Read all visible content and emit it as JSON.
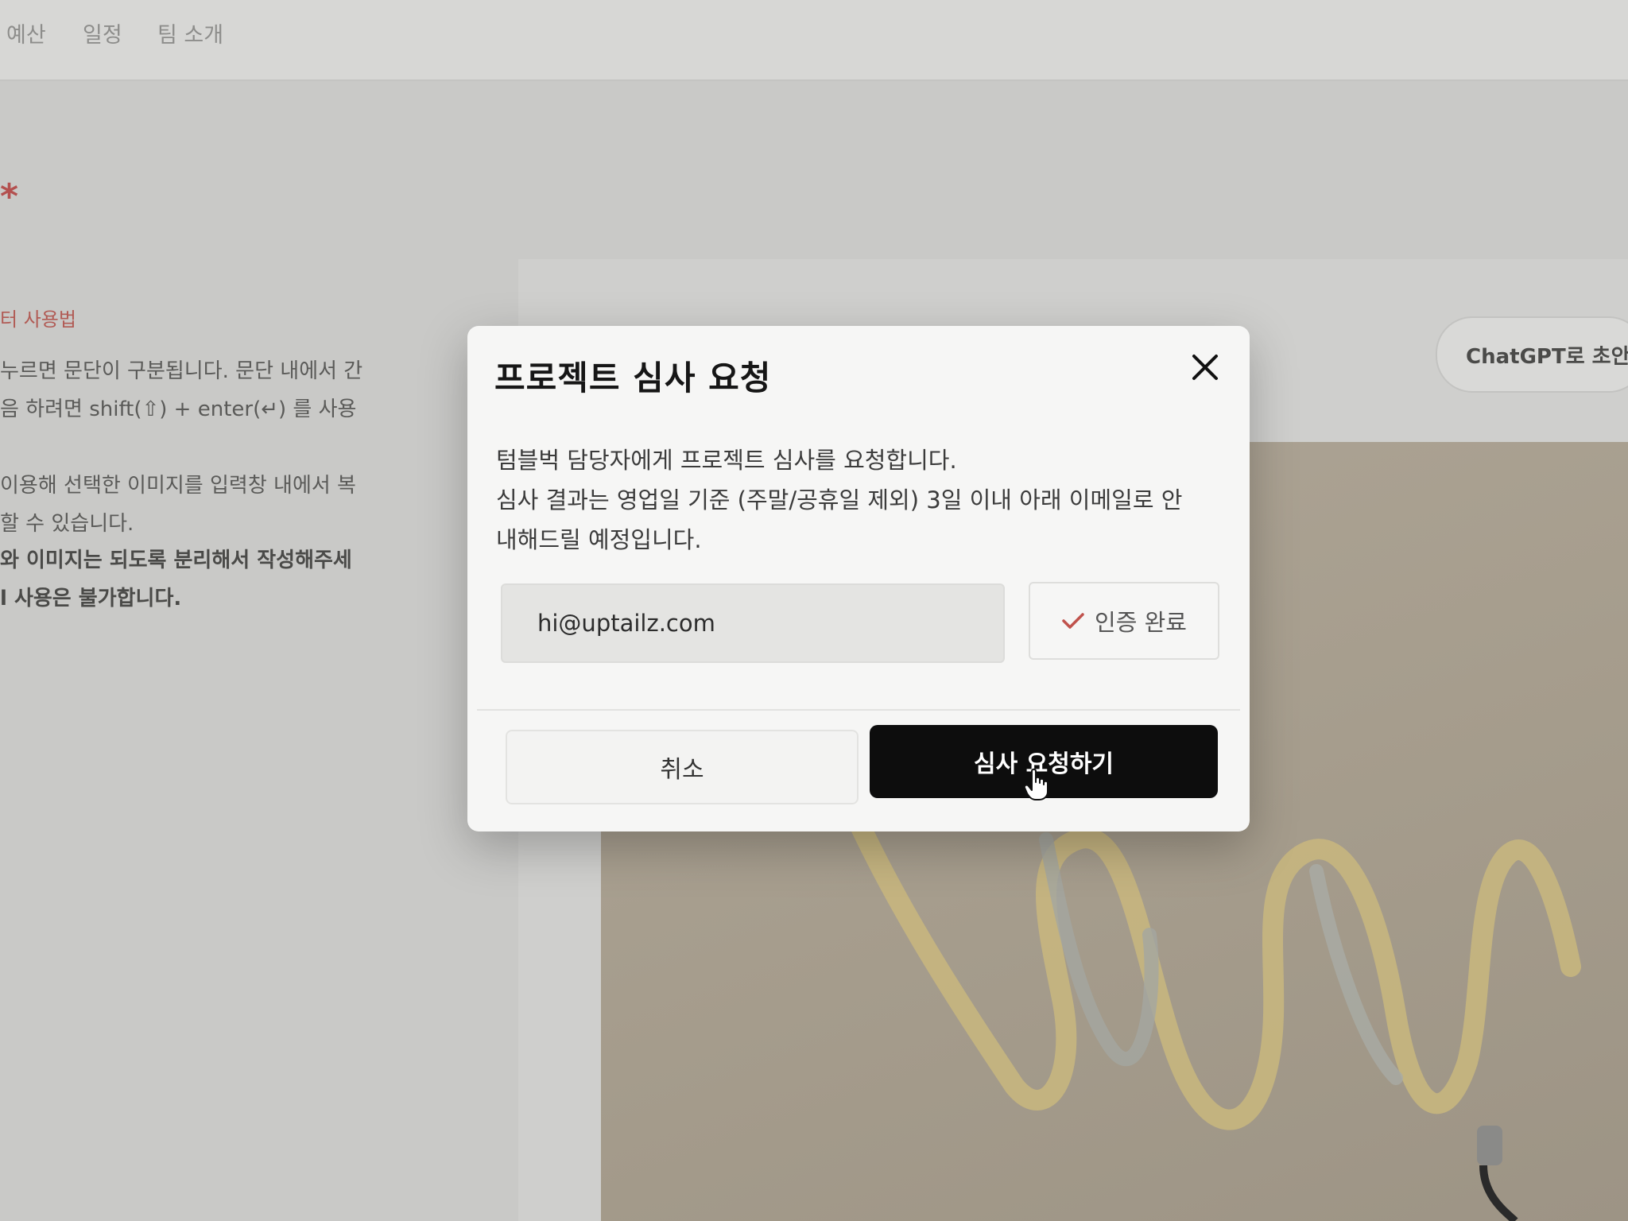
{
  "nav": {
    "items": [
      {
        "label": "예산"
      },
      {
        "label": "일정"
      },
      {
        "label": "팀 소개"
      }
    ]
  },
  "editor_help": {
    "required_mark": "*",
    "title": "터 사용법",
    "lines": [
      "누르면 문단이 구분됩니다. 문단 내에서 간",
      "음 하려면 shift(⇧) + enter(↵) 를 사용",
      "이용해 선택한 이미지를 입력창 내에서 복",
      "할 수 있습니다.",
      "와 이미지는 되도록 분리해서 작성해주세",
      "l 사용은 불가합니다."
    ]
  },
  "chatgpt_button": {
    "label": "ChatGPT로 초안"
  },
  "modal": {
    "title": "프로젝트 심사 요청",
    "description": [
      "텀블벅 담당자에게 프로젝트 심사를 요청합니다.",
      "심사 결과는 영업일 기준 (주말/공휴일 제외) 3일 이내 아래 이메일로 안",
      "내해드릴 예정입니다."
    ],
    "email": "hi@uptailz.com",
    "verified_label": "인증 완료",
    "cancel_label": "취소",
    "submit_label": "심사 요청하기"
  },
  "colors": {
    "accent_check": "#c0524c",
    "submit_bg": "#0d0d0d",
    "required_mark": "#b3504f"
  },
  "icons": {
    "close": "close-icon",
    "check": "check-icon",
    "cursor": "hand-pointer-icon"
  }
}
